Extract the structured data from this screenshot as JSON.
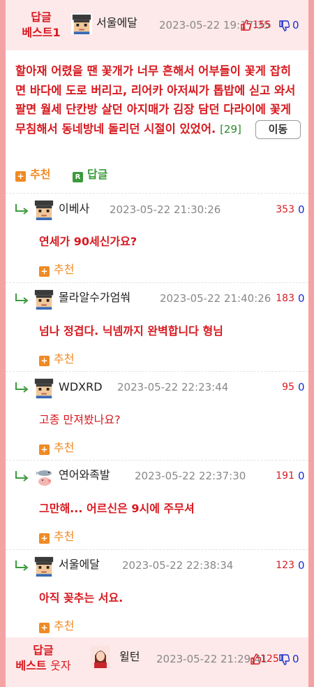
{
  "best_comment": {
    "badge_line1": "답글",
    "badge_line2": "베스트1",
    "nickname": "서울에달",
    "date": "2023-05-22 19:17:35",
    "up_count": "155",
    "down_count": "0",
    "text": "할아재 어렸을 땐 꽃개가 너무 흔해서 어부들이 꽃게 잡히면 바다에 도로 버리고, 리어카 아저씨가 톱밥에 싣고 와서 팔면 월세 단칸방 살던 아지매가 김장 담던 다라이에 꽃게 무침해서 동네방네 돌리던 시절이 있었어.",
    "reply_count": "[29]",
    "move_button": "이동",
    "recommend_label": "추천",
    "reply_label": "답글"
  },
  "replies": [
    {
      "nickname": "이베사",
      "date": "2023-05-22 21:30:26",
      "up": "353",
      "down": "0",
      "text": "연세가 90세신가요?",
      "bold": true,
      "recommend": "추천",
      "avatar": "pixel-face"
    },
    {
      "nickname": "몰라알수가엄쒀",
      "date": "2023-05-22 21:40:26",
      "up": "183",
      "down": "0",
      "text": "넘나 정겹다. 닉넴까지 완벽합니다 형님",
      "bold": true,
      "recommend": "추천",
      "avatar": "pixel-face"
    },
    {
      "nickname": "WDXRD",
      "date": "2023-05-22 22:23:44",
      "up": "95",
      "down": "0",
      "text": "고종 만져봤나요?",
      "bold": false,
      "recommend": "추천",
      "avatar": "pixel-face"
    },
    {
      "nickname": "연어와족발",
      "date": "2023-05-22 22:37:30",
      "up": "191",
      "down": "0",
      "text": "그만해... 어르신은 9시에 주무셔",
      "bold": true,
      "recommend": "추천",
      "avatar": "salmon-pig"
    },
    {
      "nickname": "서울에달",
      "date": "2023-05-22 22:38:34",
      "up": "123",
      "down": "0",
      "text": "아직 꽂추는 서요.",
      "bold": true,
      "recommend": "추천",
      "avatar": "pixel-face"
    }
  ],
  "footer_best": {
    "badge_line1": "답글",
    "badge_line2": "베스트",
    "badge_extra": "웃자",
    "nickname": "윌턴",
    "date": "2023-05-22 21:29:41",
    "up_count": "125",
    "down_count": "0"
  },
  "colors": {
    "accent_red": "#d7191f",
    "down_blue": "#1a2ecc",
    "recommend_orange": "#f08a24",
    "reply_green": "#3c9a3c",
    "best_bg": "#fde9ea",
    "page_border": "#f3a3a3"
  },
  "icons": [
    "thumbs-up-icon",
    "thumbs-down-icon",
    "reply-arrow-icon",
    "plus-icon",
    "reply-r-icon"
  ]
}
